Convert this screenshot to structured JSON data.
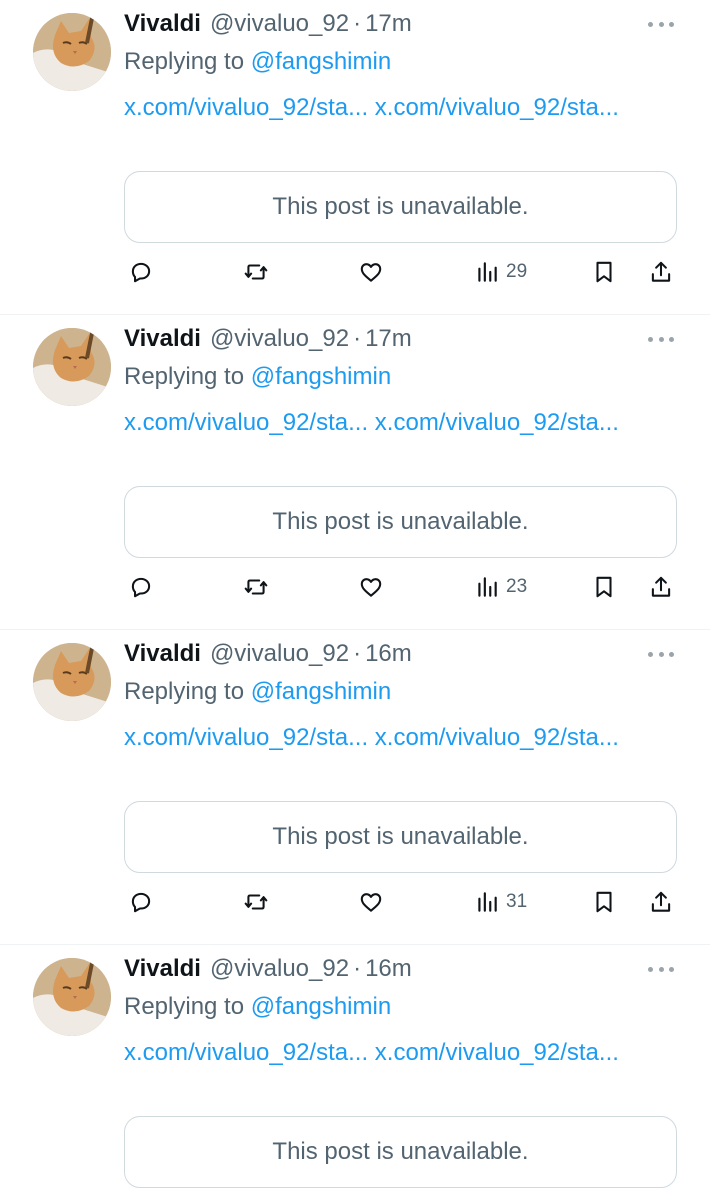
{
  "colors": {
    "link": "#1d9bf0",
    "secondary_text": "#536471",
    "border": "#cfd9de",
    "divider": "#eff3f4"
  },
  "posts": [
    {
      "name": "Vivaldi",
      "handle": "@vivaluo_92",
      "separator": "·",
      "time": "17m",
      "replying_prefix": "Replying to",
      "replying_handle": "@fangshimin",
      "link1": "x.com/vivaluo_92/sta...",
      "link2": "x.com/vivaluo_92/sta...",
      "quoted": "This post is unavailable.",
      "views": "29"
    },
    {
      "name": "Vivaldi",
      "handle": "@vivaluo_92",
      "separator": "·",
      "time": "17m",
      "replying_prefix": "Replying to",
      "replying_handle": "@fangshimin",
      "link1": "x.com/vivaluo_92/sta...",
      "link2": "x.com/vivaluo_92/sta...",
      "quoted": "This post is unavailable.",
      "views": "23"
    },
    {
      "name": "Vivaldi",
      "handle": "@vivaluo_92",
      "separator": "·",
      "time": "16m",
      "replying_prefix": "Replying to",
      "replying_handle": "@fangshimin",
      "link1": "x.com/vivaluo_92/sta...",
      "link2": "x.com/vivaluo_92/sta...",
      "quoted": "This post is unavailable.",
      "views": "31"
    },
    {
      "name": "Vivaldi",
      "handle": "@vivaluo_92",
      "separator": "·",
      "time": "16m",
      "replying_prefix": "Replying to",
      "replying_handle": "@fangshimin",
      "link1": "x.com/vivaluo_92/sta...",
      "link2": "x.com/vivaluo_92/sta...",
      "quoted": "This post is unavailable."
    }
  ]
}
